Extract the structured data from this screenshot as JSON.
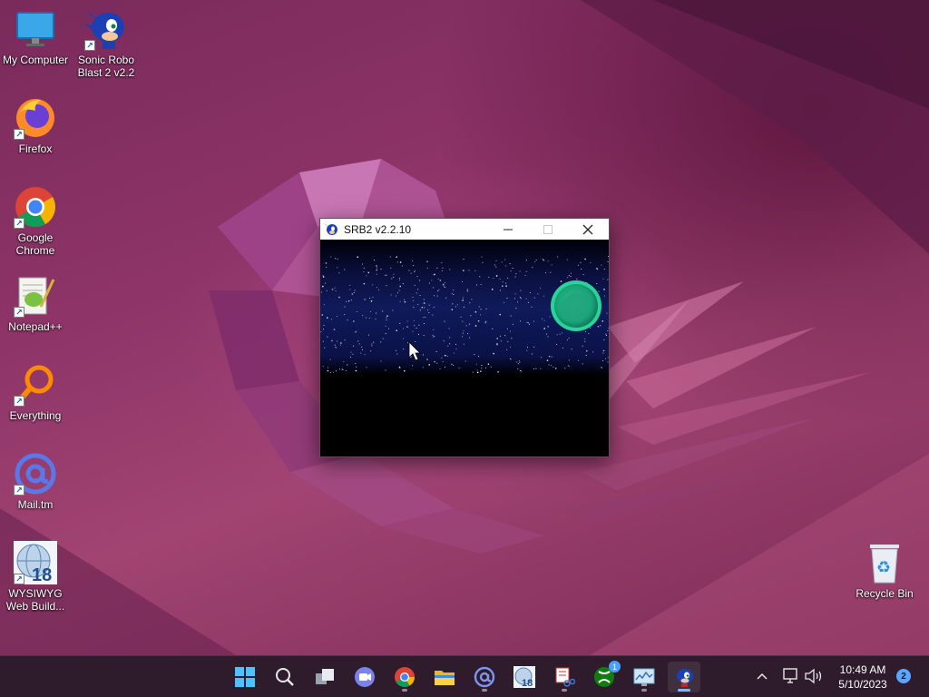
{
  "desktop": {
    "icons": [
      {
        "label": "My Computer",
        "icon": "monitor-icon"
      },
      {
        "label": "Sonic Robo\nBlast 2 v2.2",
        "icon": "sonic-icon"
      },
      {
        "label": "Firefox",
        "icon": "firefox-icon"
      },
      {
        "label": "Google\nChrome",
        "icon": "chrome-icon"
      },
      {
        "label": "Notepad++",
        "icon": "notepadpp-icon"
      },
      {
        "label": "Everything",
        "icon": "everything-search-icon"
      },
      {
        "label": "Mail.tm",
        "icon": "at-sign-icon"
      },
      {
        "label": "WYSIWYG\nWeb Build...",
        "icon": "wysiwyg-globe-icon"
      },
      {
        "label": "Recycle Bin",
        "icon": "recycle-bin-icon"
      }
    ]
  },
  "window": {
    "title": "SRB2 v2.2.10",
    "minimize": "—",
    "maximize": "☐",
    "close": "✕"
  },
  "taskbar": {
    "items": [
      {
        "name": "start",
        "icon": "windows-logo-icon"
      },
      {
        "name": "search",
        "icon": "search-icon"
      },
      {
        "name": "task-view",
        "icon": "task-view-icon"
      },
      {
        "name": "teams-chat",
        "icon": "video-chat-icon"
      },
      {
        "name": "chrome",
        "icon": "chrome-icon"
      },
      {
        "name": "file-explorer",
        "icon": "folder-icon"
      },
      {
        "name": "mail-tm",
        "icon": "at-sign-icon"
      },
      {
        "name": "wysiwyg",
        "icon": "wysiwyg-globe-icon"
      },
      {
        "name": "snipping-tool",
        "icon": "scissors-icon"
      },
      {
        "name": "xbox",
        "icon": "xbox-icon",
        "badge": "1"
      },
      {
        "name": "resource-monitor",
        "icon": "monitor-chart-icon"
      },
      {
        "name": "srb2",
        "icon": "sonic-icon"
      }
    ],
    "tray": {
      "chevron": "^",
      "time": "10:49 AM",
      "date": "5/10/2023",
      "notifications": "2"
    }
  },
  "colors": {
    "accent": "#4aa0ff",
    "desktop_base": "#8e3468",
    "taskbar": "#2e1b2c"
  }
}
